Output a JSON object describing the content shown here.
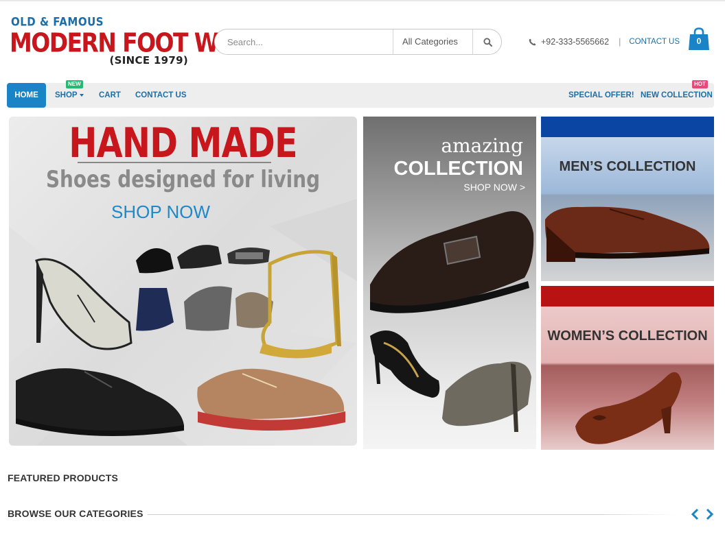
{
  "header": {
    "logo": {
      "line1": "OLD & FAMOUS",
      "line2": "MODERN FOOT WEAR",
      "line3": "(SINCE 1979)"
    },
    "search": {
      "placeholder": "Search...",
      "category": "All Categories"
    },
    "phone": "+92-333-5565662",
    "contact_label": "CONTACT US",
    "cart_count": "0"
  },
  "nav": {
    "items": [
      {
        "label": "HOME"
      },
      {
        "label": "SHOP",
        "badge": "NEW"
      },
      {
        "label": "CART"
      },
      {
        "label": "CONTACT US"
      }
    ],
    "right_items": [
      {
        "label": "SPECIAL OFFER!"
      },
      {
        "label": "NEW COLLECTION",
        "badge": "HOT"
      }
    ]
  },
  "banners": {
    "handmade": {
      "title": "HAND MADE",
      "subtitle": "Shoes designed for living",
      "cta": "SHOP NOW"
    },
    "amazing": {
      "line1": "amazing",
      "line2": "COLLECTION",
      "cta": "SHOP NOW >"
    },
    "mens": {
      "label": "MEN’S COLLECTION"
    },
    "womens": {
      "label": "WOMEN’S COLLECTION"
    }
  },
  "sections": {
    "featured": "FEATURED PRODUCTS",
    "browse": "BROWSE OUR CATEGORIES"
  },
  "colors": {
    "brand_blue": "#1c6ea8",
    "brand_red": "#c8161d",
    "nav_active": "#1a84c6",
    "badge_new": "#2bb673",
    "badge_hot": "#e64a7a"
  }
}
